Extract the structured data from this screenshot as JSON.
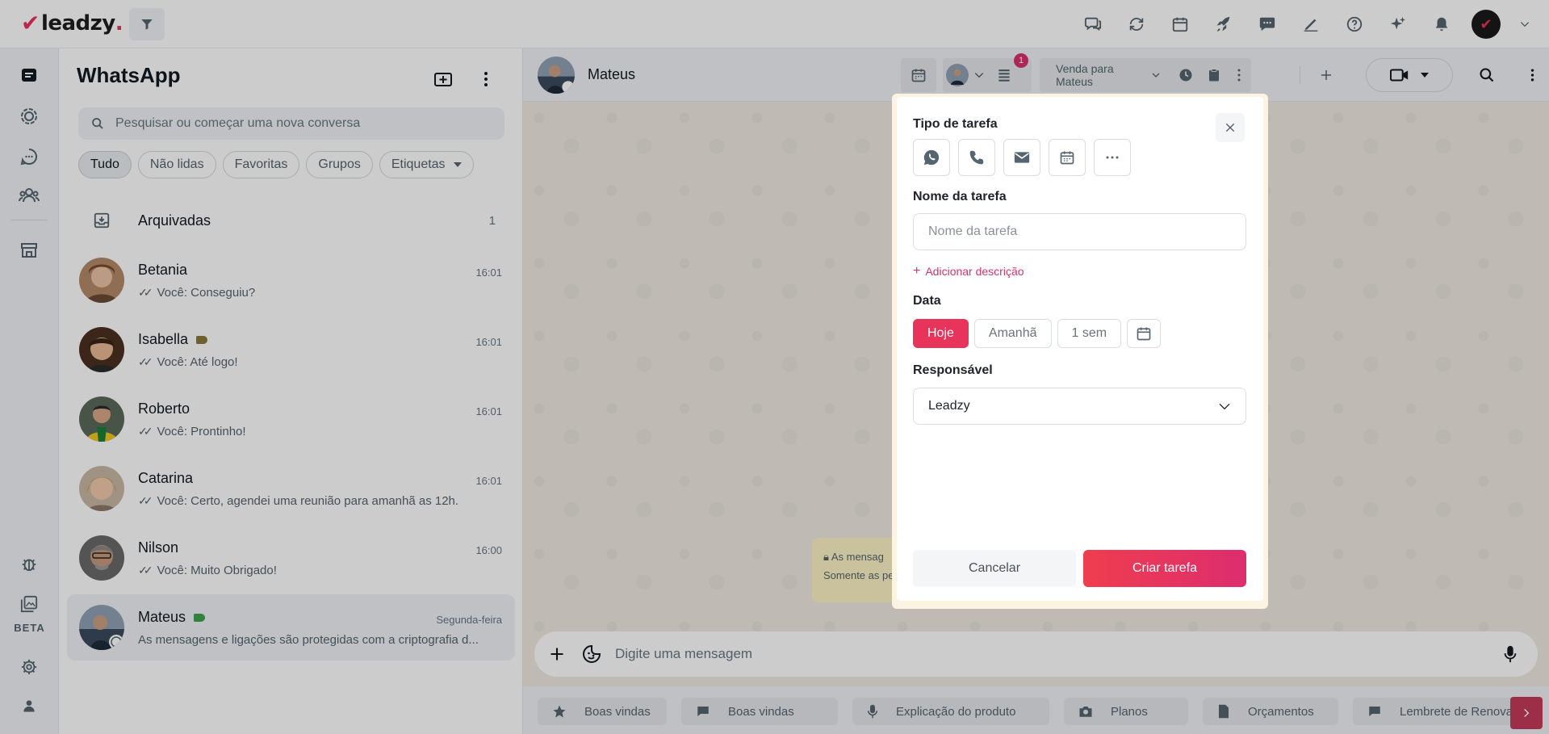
{
  "app": {
    "logo_text": "leadzy",
    "logo_dot": ".",
    "accent": "#e8335a",
    "top_icons": [
      "chat-bubbles-icon",
      "sync-icon",
      "calendar-icon",
      "rocket-icon",
      "comment-dots-icon",
      "pen-icon",
      "help-icon",
      "sparkles-icon",
      "bell-icon"
    ]
  },
  "rail": {
    "items": [
      "chats-icon",
      "status-icon",
      "channels-icon",
      "communities-icon",
      "store-icon"
    ],
    "bottom_items": [
      "bug-icon",
      "media-icon",
      "settings-icon",
      "profile-icon"
    ],
    "beta_label": "BETA"
  },
  "chatlist": {
    "title": "WhatsApp",
    "search_placeholder": "Pesquisar ou começar uma nova conversa",
    "filters": [
      "Tudo",
      "Não lidas",
      "Favoritas",
      "Grupos",
      "Etiquetas"
    ],
    "active_filter": "Tudo",
    "archived_label": "Arquivadas",
    "archived_count": "1",
    "chats": [
      {
        "name": "Betania",
        "time": "16:01",
        "preview": "Você: Conseguiu?",
        "tag": false
      },
      {
        "name": "Isabella",
        "time": "16:01",
        "preview": "Você: Até logo!",
        "tag": true
      },
      {
        "name": "Roberto",
        "time": "16:01",
        "preview": "Você: Prontinho!",
        "tag": false
      },
      {
        "name": "Catarina",
        "time": "16:01",
        "preview": "Você: Certo, agendei uma reunião para amanhã as 12h.",
        "tag": false
      },
      {
        "name": "Nilson",
        "time": "16:00",
        "preview": "Você: Muito Obrigado!",
        "tag": false
      },
      {
        "name": "Mateus",
        "time": "Segunda-feira",
        "preview": "As mensagens e ligações são protegidas com a criptografia d...",
        "tag": true
      }
    ]
  },
  "conversation": {
    "contact_name": "Mateus",
    "tasks_badge": "1",
    "deal_label": "Venda para Mateus",
    "system_message_line1": "As mensag",
    "system_message_line2": "Somente as pe",
    "composer_placeholder": "Digite uma mensagem",
    "quick_replies": [
      {
        "icon": "star-icon",
        "label": "Boas vindas"
      },
      {
        "icon": "chat-icon",
        "label": "Boas vindas"
      },
      {
        "icon": "mic-icon",
        "label": "Explicação do produto"
      },
      {
        "icon": "camera-icon",
        "label": "Planos"
      },
      {
        "icon": "document-icon",
        "label": "Orçamentos"
      },
      {
        "icon": "chat-icon",
        "label": "Lembrete de Renovação d"
      }
    ]
  },
  "modal": {
    "task_type_label": "Tipo de tarefa",
    "task_types": [
      "whatsapp-icon",
      "phone-icon",
      "email-icon",
      "calendar-icon",
      "more-icon"
    ],
    "task_name_label": "Nome da tarefa",
    "task_name_placeholder": "Nome da tarefa",
    "add_description": "Adicionar descrição",
    "date_label": "Data",
    "date_options": [
      "Hoje",
      "Amanhã",
      "1 sem"
    ],
    "date_selected": "Hoje",
    "responsible_label": "Responsável",
    "responsible_value": "Leadzy",
    "cancel_label": "Cancelar",
    "create_label": "Criar tarefa"
  }
}
